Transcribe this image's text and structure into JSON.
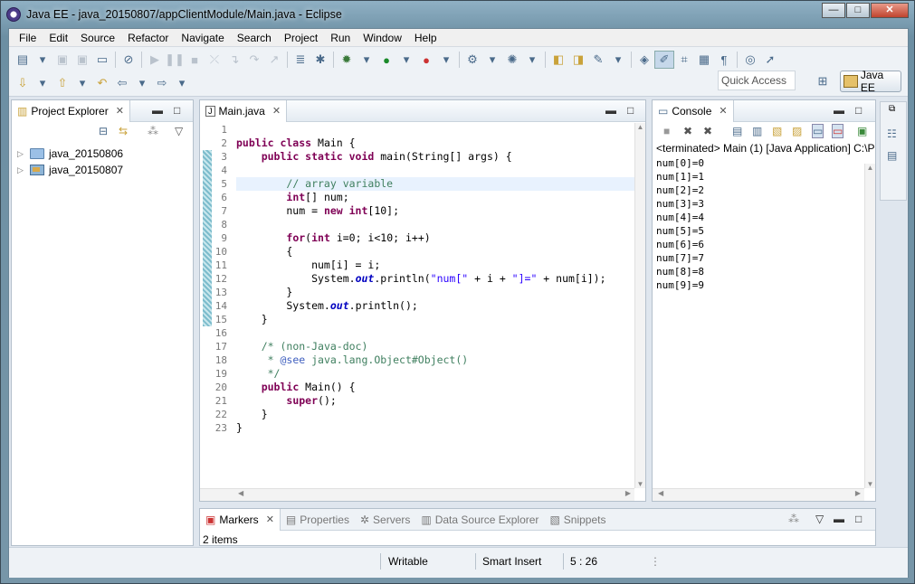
{
  "window": {
    "title": "Java EE - java_20150807/appClientModule/Main.java - Eclipse",
    "btn_min": "—",
    "btn_max": "□",
    "btn_close": "✕"
  },
  "menu": [
    "File",
    "Edit",
    "Source",
    "Refactor",
    "Navigate",
    "Search",
    "Project",
    "Run",
    "Window",
    "Help"
  ],
  "toolbar": {
    "quick_access": "Quick Access",
    "perspective": "Java EE"
  },
  "explorer": {
    "tab": "Project Explorer",
    "items": [
      {
        "label": "java_20150806"
      },
      {
        "label": "java_20150807"
      }
    ]
  },
  "editor": {
    "tab": "Main.java",
    "lines": [
      {
        "n": "1",
        "html": ""
      },
      {
        "n": "2",
        "html": "<span class='kw'>public class</span> Main {"
      },
      {
        "n": "3",
        "html": "    <span class='kw'>public static void</span> main(String[] args) {"
      },
      {
        "n": "4",
        "html": ""
      },
      {
        "n": "5",
        "html": "        <span class='cm'>// array variable</span>"
      },
      {
        "n": "6",
        "html": "        <span class='kw'>int</span>[] num;"
      },
      {
        "n": "7",
        "html": "        num = <span class='kw'>new int</span>[10];"
      },
      {
        "n": "8",
        "html": ""
      },
      {
        "n": "9",
        "html": "        <span class='kw'>for</span>(<span class='kw'>int</span> i=0; i&lt;10; i++)"
      },
      {
        "n": "10",
        "html": "        {"
      },
      {
        "n": "11",
        "html": "            num[i] = i;"
      },
      {
        "n": "12",
        "html": "            System.<span class='fi'>out</span>.println(<span class='st'>\"num[\"</span> + i + <span class='st'>\"]=\"</span> + num[i]);"
      },
      {
        "n": "13",
        "html": "        }"
      },
      {
        "n": "14",
        "html": "        System.<span class='fi'>out</span>.println();"
      },
      {
        "n": "15",
        "html": "    }"
      },
      {
        "n": "16",
        "html": ""
      },
      {
        "n": "17",
        "html": "    <span class='cm'>/* (non-Java-doc)</span>"
      },
      {
        "n": "18",
        "html": "<span class='cm'>     * </span><span class='jd'>@see</span><span class='cm'> java.lang.Object#Object()</span>"
      },
      {
        "n": "19",
        "html": "<span class='cm'>     */</span>"
      },
      {
        "n": "20",
        "html": "    <span class='kw'>public</span> Main() {"
      },
      {
        "n": "21",
        "html": "        <span class='kw'>super</span>();"
      },
      {
        "n": "22",
        "html": "    }"
      },
      {
        "n": "23",
        "html": "}"
      }
    ]
  },
  "console": {
    "tab": "Console",
    "header": "<terminated> Main (1) [Java Application] C:\\P",
    "output": [
      "num[0]=0",
      "num[1]=1",
      "num[2]=2",
      "num[3]=3",
      "num[4]=4",
      "num[5]=5",
      "num[6]=6",
      "num[7]=7",
      "num[8]=8",
      "num[9]=9"
    ]
  },
  "bottom": {
    "tabs": [
      "Markers",
      "Properties",
      "Servers",
      "Data Source Explorer",
      "Snippets"
    ],
    "summary": "2 items"
  },
  "status": {
    "writable": "Writable",
    "insert": "Smart Insert",
    "position": "5 : 26"
  }
}
